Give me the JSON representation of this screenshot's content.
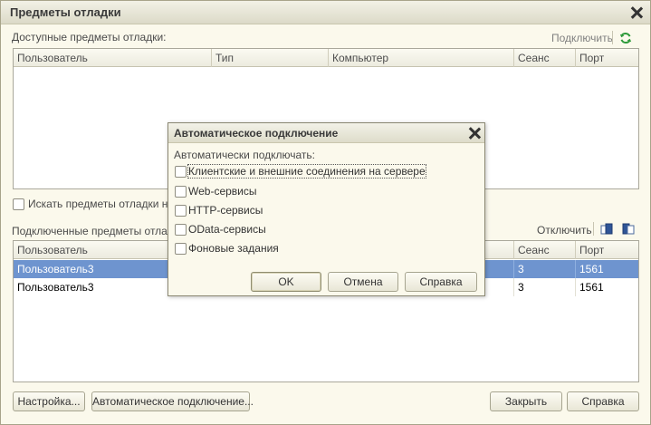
{
  "window": {
    "title": "Предметы отладки",
    "close_icon": "close-icon"
  },
  "available": {
    "label": "Доступные предметы отладки:",
    "connect_link": "Подключить",
    "refresh_icon": "refresh-icon",
    "columns": [
      "Пользователь",
      "Тип",
      "Компьютер",
      "Сеанс",
      "Порт"
    ],
    "rows": []
  },
  "search_checkbox": {
    "label": "Искать предметы отладки на у"
  },
  "connected": {
    "label": "Подключенные предметы отладк",
    "disconnect_link": "Отключить",
    "columns": [
      "Пользователь",
      "Сеанс",
      "Порт"
    ],
    "rows": [
      {
        "user": "Пользователь3",
        "session": "3",
        "port": "1561",
        "selected": true
      },
      {
        "user": "Пользователь3",
        "session": "3",
        "port": "1561",
        "selected": false
      }
    ]
  },
  "footer": {
    "settings": "Настройка...",
    "auto_connect": "Автоматическое подключение...",
    "close": "Закрыть",
    "help": "Справка"
  },
  "dialog": {
    "title": "Автоматическое подключение",
    "prompt": "Автоматически подключать:",
    "options": [
      {
        "label": "Клиентские и внешние соединения на сервере",
        "checked": false
      },
      {
        "label": "Web-сервисы",
        "checked": false
      },
      {
        "label": "HTTP-сервисы",
        "checked": false
      },
      {
        "label": "OData-сервисы",
        "checked": false
      },
      {
        "label": "Фоновые задания",
        "checked": false
      }
    ],
    "ok": "OK",
    "cancel": "Отмена",
    "help": "Справка"
  },
  "colors": {
    "selected_row": "#6e94cf",
    "background": "#fbf9ec",
    "refresh_green": "#2e9a3a"
  }
}
